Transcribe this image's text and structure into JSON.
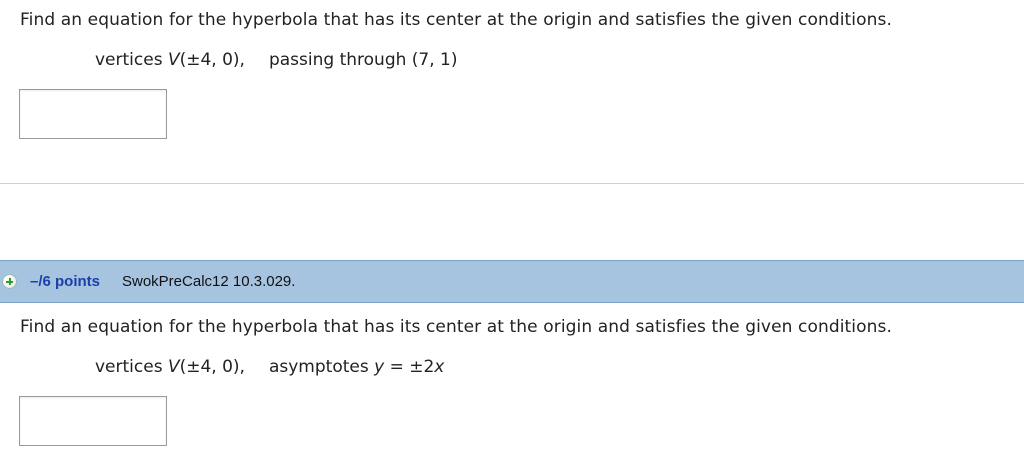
{
  "question1": {
    "prompt": "Find an equation for the hyperbola that has its center at the origin and satisfies the given conditions.",
    "vertices_label": "vertices ",
    "vertices_var": "V",
    "vertices_value": "(±4, 0),",
    "second_condition": "passing through (7, 1)",
    "answer_value": ""
  },
  "question2": {
    "header": {
      "points": "–/6 points",
      "question_id": "SwokPreCalc12 10.3.029."
    },
    "prompt": "Find an equation for the hyperbola that has its center at the origin and satisfies the given conditions.",
    "vertices_label": "vertices ",
    "vertices_var": "V",
    "vertices_value": "(±4, 0),",
    "asymptotes_label": "asymptotes ",
    "asymptotes_var": "y",
    "asymptotes_eq": " = ±2",
    "asymptotes_x": "x",
    "answer_value": ""
  },
  "colors": {
    "header_bg": "#a6c4e0",
    "points_text": "#1d3ea8",
    "plus_icon": "#2e9b2e"
  }
}
